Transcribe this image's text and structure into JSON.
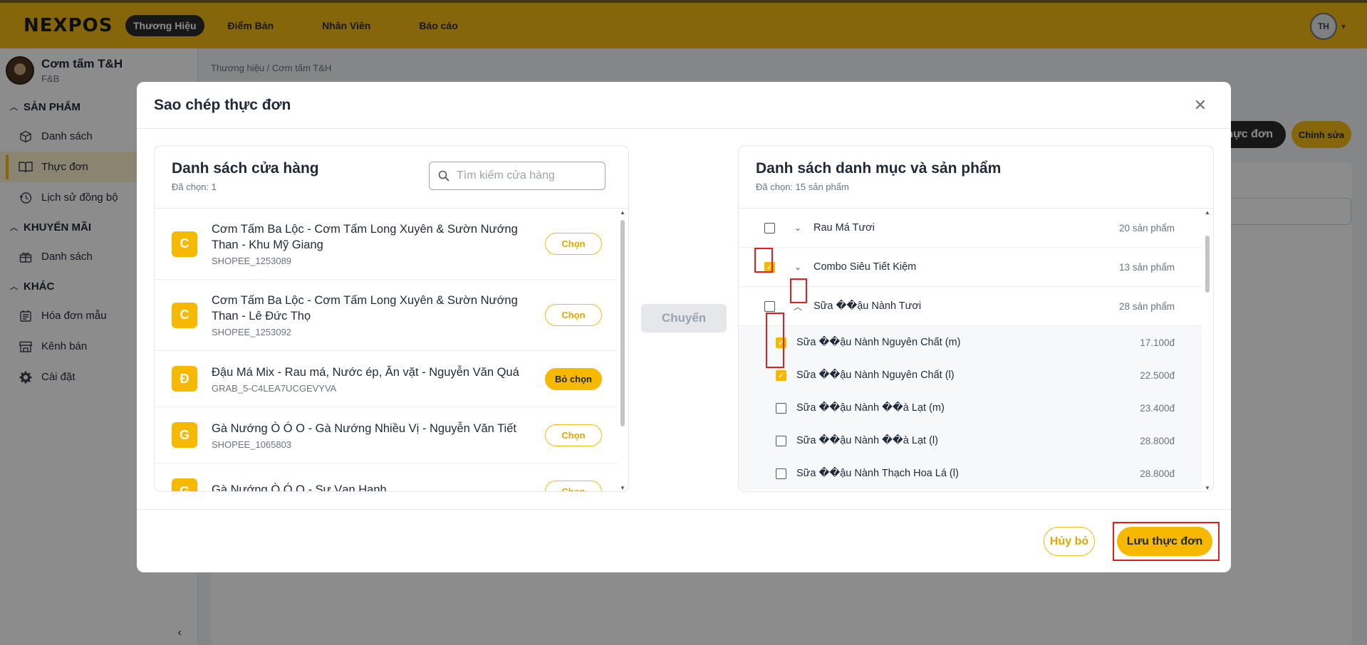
{
  "topbar": {
    "logo": "NEXPOS",
    "nav": [
      "Thương Hiệu",
      "Điểm Bán",
      "Nhân Viên",
      "Báo cáo"
    ],
    "user_initials": "TH"
  },
  "sidebar": {
    "brand_name": "Cơm tấm T&H",
    "brand_type": "F&B",
    "sections": [
      {
        "title": "SẢN PHẨM",
        "items": [
          "Danh sách",
          "Thực đơn",
          "Lịch sử đồng bộ"
        ]
      },
      {
        "title": "KHUYẾN MÃI",
        "items": [
          "Danh sách"
        ]
      },
      {
        "title": "KHÁC",
        "items": [
          "Hóa đơn mẫu",
          "Kênh bán",
          "Cài đặt"
        ]
      }
    ]
  },
  "main": {
    "breadcrumb": "Thương hiệu  /  Cơm tấm T&H",
    "dark_button": "thực đơn",
    "edit_button": "Chỉnh sửa"
  },
  "modal": {
    "title": "Sao chép thực đơn",
    "store_panel": {
      "title": "Danh sách cửa hàng",
      "selected": "Đã chọn: 1",
      "search_placeholder": "Tìm kiếm cửa hàng",
      "stores": [
        {
          "initial": "C",
          "name": "Cơm Tấm Ba Lộc - Cơm Tấm Long Xuyên & Sườn Nướng Than - Khu Mỹ Giang",
          "code": "SHOPEE_1253089",
          "button": "Chọn",
          "selected": false
        },
        {
          "initial": "C",
          "name": "Cơm Tấm Ba Lộc - Cơm Tấm Long Xuyên & Sườn Nướng Than - Lê Đức Thọ",
          "code": "SHOPEE_1253092",
          "button": "Chọn",
          "selected": false
        },
        {
          "initial": "Đ",
          "name": "Đậu Má Mix - Rau má, Nước ép, Ăn vặt - Nguyễn Văn Quá",
          "code": "GRAB_5-C4LEA7UCGEVYVA",
          "button": "Bỏ chọn",
          "selected": true
        },
        {
          "initial": "G",
          "name": "Gà Nướng Ò Ó O - Gà Nướng Nhiều Vị - Nguyễn Văn Tiết",
          "code": "SHOPEE_1065803",
          "button": "Chọn",
          "selected": false
        },
        {
          "initial": "G",
          "name": "Gà Nướng Ò Ó O - Sư Vạn Hạnh",
          "code": "",
          "button": "Chọn",
          "selected": false
        }
      ]
    },
    "transfer_button": "Chuyển",
    "category_panel": {
      "title": "Danh sách danh mục và sản phẩm",
      "selected": "Đã chọn: 15 sản phẩm",
      "categories": [
        {
          "name": "Rau Má Tươi",
          "count": "20 sản phẩm",
          "checked": false,
          "expanded": false
        },
        {
          "name": "Combo Siêu Tiết Kiệm",
          "count": "13 sản phẩm",
          "checked": true,
          "expanded": false
        },
        {
          "name": "Sữa ��ậu Nành Tươi",
          "count": "28 sản phẩm",
          "checked": false,
          "expanded": true
        }
      ],
      "products": [
        {
          "name": "Sữa ��ậu Nành Nguyên Chất (m)",
          "price": "17.100đ",
          "checked": true
        },
        {
          "name": "Sữa ��ậu Nành Nguyên Chất (l)",
          "price": "22.500đ",
          "checked": true
        },
        {
          "name": "Sữa ��ậu Nành ��à Lạt (m)",
          "price": "23.400đ",
          "checked": false
        },
        {
          "name": "Sữa ��ậu Nành ��à Lạt (l)",
          "price": "28.800đ",
          "checked": false
        },
        {
          "name": "Sữa ��ậu Nành Thạch Hoa Lá (l)",
          "price": "28.800đ",
          "checked": false
        }
      ]
    },
    "footer": {
      "cancel": "Hủy bỏ",
      "save": "Lưu thực đơn"
    }
  },
  "colors": {
    "brand_yellow": "#f2bb13",
    "accent_yellow": "#f7b900",
    "highlight_red": "#e11d1d",
    "dark": "#2a2a2a"
  }
}
